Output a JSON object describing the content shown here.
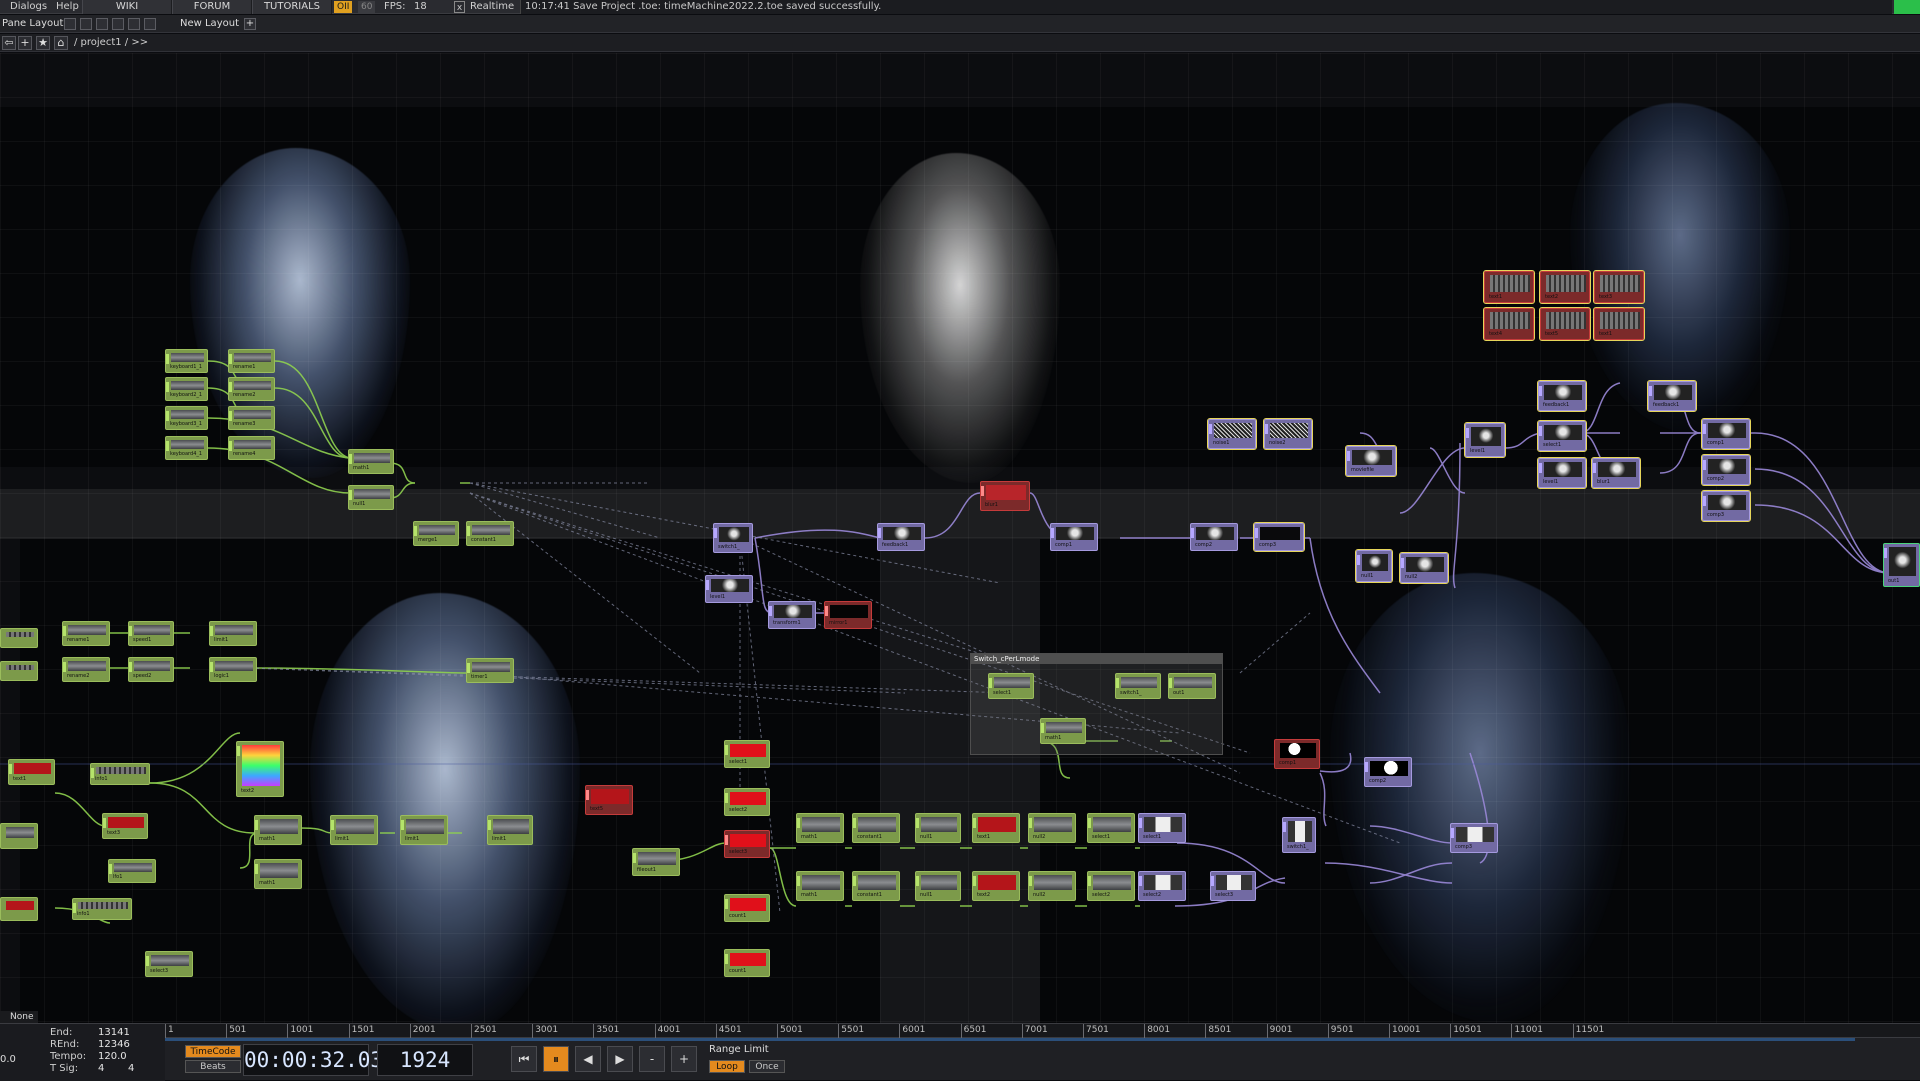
{
  "menu": {
    "items": [
      "Dialogs",
      "Help"
    ],
    "tabs": [
      "WIKI",
      "FORUM",
      "TUTORIALS"
    ],
    "oii": "OII",
    "sixty": "60",
    "fps_label": "FPS:",
    "fps_value": "18",
    "realtime_check": "x",
    "realtime_label": "Realtime",
    "message": "10:17:41 Save Project .toe: timeMachine2022.2.toe saved successfully."
  },
  "pane": {
    "label": "Pane Layout",
    "new_layout": "New Layout",
    "add": "+"
  },
  "path": {
    "text": "/ project1 / >>",
    "back": "⇦",
    "add": "+",
    "star": "★",
    "home": "⌂"
  },
  "comp": {
    "title": "Switch_cPerLmode"
  },
  "nodes": {
    "keyboard1": "keyboard1_1",
    "keyboard2": "keyboard2_1",
    "keyboard3": "keyboard3_1",
    "keyboard4": "keyboard4_1",
    "rename1": "rename1",
    "rename2": "rename2",
    "rename3": "rename3",
    "rename4": "rename4",
    "math1": "math1",
    "merge1": "merge1",
    "constant1": "constant1",
    "switch1": "switch1_",
    "transform1": "transform1",
    "mirror1": "mirror1",
    "noise1": "noise1",
    "noise2": "noise2",
    "moviefile": "moviefile",
    "level1": "level1",
    "feedback1": "feedback1",
    "blur1": "blur1",
    "comp1": "comp1",
    "comp2": "comp2",
    "comp3": "comp3",
    "null1": "null1",
    "null2": "null2",
    "out1": "out1",
    "select1": "select1",
    "select2": "select2",
    "select3": "select3",
    "speed1": "speed1",
    "speed2": "speed2",
    "limit1": "limit1",
    "logic1": "logic1",
    "timer1": "timer1",
    "info1": "info1",
    "text1": "text1",
    "text2": "text2",
    "text3": "text3",
    "text4": "text4",
    "text5": "text5",
    "lfo1": "lfo1",
    "count1": "count1",
    "fileout1": "fileout1"
  },
  "timeline": {
    "end_label": "End:",
    "end_value": "13141",
    "rend_label": "REnd:",
    "rend_value": "12346",
    "tempo_label": "Tempo:",
    "tempo_value": "120.0",
    "tsig_label": "T Sig:",
    "tsig_a": "4",
    "tsig_b": "4",
    "zero": "0.0",
    "ticks": [
      "1",
      "501",
      "1001",
      "1501",
      "2001",
      "2501",
      "3001",
      "3501",
      "4001",
      "4501",
      "5001",
      "5501",
      "6001",
      "6501",
      "7001",
      "7501",
      "8001",
      "8501",
      "9001",
      "9501",
      "10001",
      "10501",
      "11001",
      "11501"
    ],
    "timecode_btn": "TimeCode",
    "beats_btn": "Beats",
    "timecode": "00:00:32.03",
    "frame": "1924",
    "range_limit": "Range Limit",
    "loop": "Loop",
    "once": "Once",
    "btn_rewind": "⏮",
    "btn_pause": "⏸",
    "btn_back": "◀",
    "btn_fwd": "▶",
    "btn_minus": "-",
    "btn_plus": "+"
  },
  "swatch": {
    "none": "None",
    "colors": [
      "#4bd35a",
      "#3ad6c7",
      "#d63adf",
      "#4b8ef2"
    ]
  },
  "colors": {
    "chop": "#7c9a4a",
    "top": "#726aa3",
    "wire_chop": "#8fd14f",
    "wire_top": "#9a88d8",
    "status_green": "#2bbf4a"
  }
}
